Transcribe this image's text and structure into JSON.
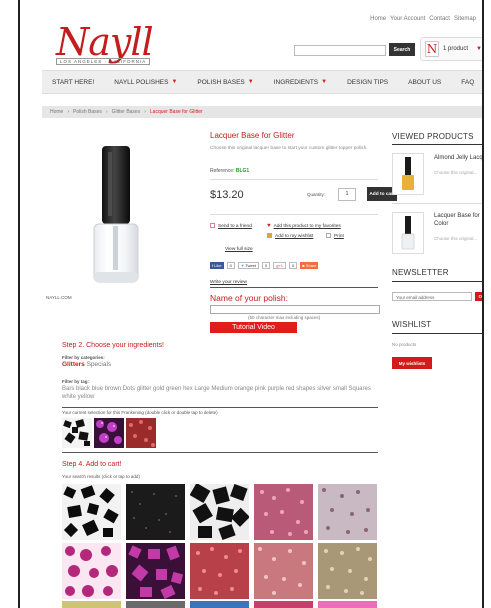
{
  "top_links": [
    "Home",
    "Your Account",
    "Contact",
    "Sitemap"
  ],
  "logo": {
    "script": "Nayll",
    "tagline": "LOS ANGELES · CALIFORNIA"
  },
  "search": {
    "button": "Search",
    "value": ""
  },
  "cart": {
    "count_label": "1 product"
  },
  "nav": [
    "START HERE!",
    "NAYLL POLISHES",
    "POLISH BASES",
    "INGREDIENTS",
    "DESIGN TIPS",
    "ABOUT US",
    "FAQ"
  ],
  "breadcrumb": [
    "Home",
    "Polish Bases",
    "Glitter Bases",
    "Lacquer Base for Glitter"
  ],
  "product": {
    "title": "Lacquer Base for Glitter",
    "description": "Choose this original lacquer base to start your custom glitter topper polish.",
    "reference_label": "Reference:",
    "reference": "BLG1",
    "price": "$13.20",
    "quantity_label": "Quantity:",
    "quantity": "1",
    "add_to_cart": "Add to cart",
    "image_caption": "NAYLL.COM",
    "links": {
      "send_friend": "Send to a friend",
      "add_favorites": "Add this product to my favorites",
      "add_wishlist": "Add to my wishlist",
      "print": "Print",
      "view_full_size": "View full size"
    },
    "social": {
      "like": "Like",
      "like_count": "0",
      "tweet": "Tweet",
      "tweet_count": "0",
      "plus": "+1",
      "plus_count": "0",
      "share": "Share"
    },
    "write_review": "Write your review",
    "name_label": "Name of your polish:",
    "name_value": "",
    "name_hint": "(50 character max including spaces)",
    "tutorial": "Tutorial Video"
  },
  "sidebar": {
    "viewed_title": "VIEWED PRODUCTS",
    "viewed": [
      {
        "name": "Almond Jelly Lacquer",
        "desc": "Choose this original..."
      },
      {
        "name": "Lacquer Base for Color",
        "desc": "Choose this original..."
      }
    ],
    "newsletter_title": "NEWSLETTER",
    "email_placeholder": "Your email address",
    "ok": "Ok",
    "wishlist_title": "WISHLIST",
    "no_products": "No products",
    "my_wishlists": "My wishlists"
  },
  "step2": {
    "heading": "Step 2. Choose your ingredients!",
    "filter_category_label": "Filter by categories:",
    "categories": [
      "Glitters",
      "Specials"
    ],
    "filter_tag_label": "Filter by tag:",
    "tags": "Bars black blue brown Dots glitter gold green hex Large Medium orange pink purple red shapes silver small Squares white yellow",
    "selection_label": "Your current selection for this Frankening (double click or double tap to delete)"
  },
  "step4": {
    "heading": "Step 4. Add to cart!",
    "results_label": "Your search results (click or tap to add)"
  },
  "colors": {
    "brand_red": "#c31d1d",
    "button_dark": "#333333",
    "button_red": "#d21b1b"
  }
}
